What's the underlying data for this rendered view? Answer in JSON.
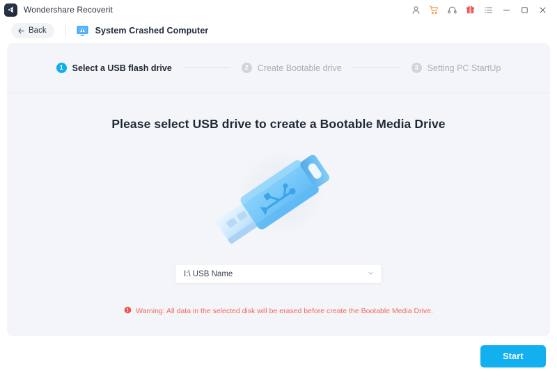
{
  "titlebar": {
    "app_name": "Wondershare Recoverit",
    "logo_icon": "recoverit-logo-icon",
    "icons": [
      {
        "name": "account-icon",
        "label": "Account",
        "color": "#6b7280"
      },
      {
        "name": "cart-icon",
        "label": "Store",
        "color": "#f59138"
      },
      {
        "name": "headset-icon",
        "label": "Support",
        "color": "#6b7280"
      },
      {
        "name": "gift-icon",
        "label": "Gift",
        "color": "#ef4444"
      },
      {
        "name": "menu-list-icon",
        "label": "Menu",
        "color": "#6b7280"
      },
      {
        "name": "minimize-icon",
        "label": "Minimize",
        "color": "#4b5563"
      },
      {
        "name": "maximize-icon",
        "label": "Maximize",
        "color": "#4b5563"
      },
      {
        "name": "close-icon",
        "label": "Close",
        "color": "#4b5563"
      }
    ]
  },
  "navbar": {
    "back_label": "Back",
    "back_icon": "arrow-left-icon",
    "mode_icon": "crashed-computer-icon",
    "mode_label": "System Crashed Computer"
  },
  "stepper": {
    "steps": [
      {
        "num": "1",
        "label": "Select a USB flash drive",
        "state": "active"
      },
      {
        "num": "2",
        "label": "Create Bootable drive",
        "state": "idle"
      },
      {
        "num": "3",
        "label": "Setting PC StartUp",
        "state": "idle"
      }
    ]
  },
  "main": {
    "heading": "Please select USB drive to create a Bootable Media Drive",
    "illustration": "usb-flash-drive-illustration",
    "select": {
      "value": "I:\\ USB Name",
      "placeholder": "I:\\ USB Name",
      "chevron_icon": "chevron-down-icon"
    },
    "warning": {
      "icon": "warning-exclamation-icon",
      "text": "Warning: All data in the selected disk will be erased before create the Bootable Media Drive.",
      "color": "#f0675f"
    }
  },
  "footer": {
    "start_label": "Start",
    "accent_color": "#13b0f0"
  }
}
